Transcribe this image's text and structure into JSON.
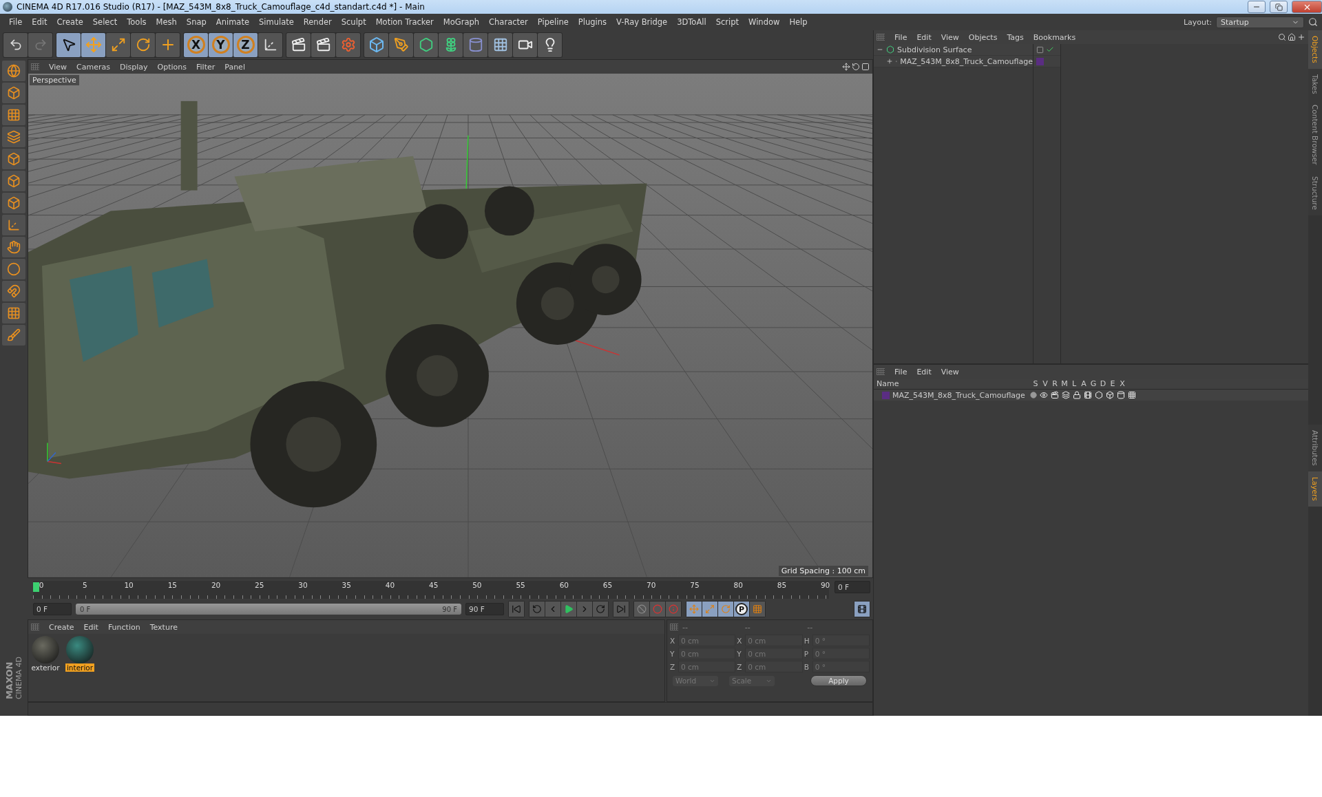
{
  "window": {
    "title": "CINEMA 4D R17.016 Studio (R17) - [MAZ_543M_8x8_Truck_Camouflage_c4d_standart.c4d *] - Main"
  },
  "menu": [
    "File",
    "Edit",
    "Create",
    "Select",
    "Tools",
    "Mesh",
    "Snap",
    "Animate",
    "Simulate",
    "Render",
    "Sculpt",
    "Motion Tracker",
    "MoGraph",
    "Character",
    "Pipeline",
    "Plugins",
    "V-Ray Bridge",
    "3DToAll",
    "Script",
    "Window",
    "Help"
  ],
  "layout": {
    "label": "Layout:",
    "value": "Startup"
  },
  "toolbar": [
    {
      "kind": "undo",
      "selected": false
    },
    {
      "kind": "redo",
      "selected": false
    },
    {
      "kind": "select",
      "selected": true
    },
    {
      "kind": "move",
      "selected": true
    },
    {
      "kind": "scale",
      "selected": false
    },
    {
      "kind": "rotate",
      "selected": false
    },
    {
      "kind": "transform",
      "selected": false
    },
    {
      "kind": "axis",
      "label": "X",
      "selected": true
    },
    {
      "kind": "axis",
      "label": "Y",
      "selected": true
    },
    {
      "kind": "axis",
      "label": "Z",
      "selected": true
    },
    {
      "kind": "coords",
      "selected": false
    },
    {
      "kind": "render",
      "selected": false
    },
    {
      "kind": "render",
      "selected": false
    },
    {
      "kind": "settings",
      "selected": false
    },
    {
      "kind": "cube",
      "selected": false
    },
    {
      "kind": "pen",
      "selected": false
    },
    {
      "kind": "subdivision",
      "selected": false
    },
    {
      "kind": "cloner",
      "selected": false
    },
    {
      "kind": "deformer",
      "selected": false
    },
    {
      "kind": "floor",
      "selected": false
    },
    {
      "kind": "camera",
      "selected": false
    },
    {
      "kind": "light",
      "selected": false
    }
  ],
  "viewport": {
    "menu": [
      "View",
      "Cameras",
      "Display",
      "Options",
      "Filter",
      "Panel"
    ],
    "camera_label": "Perspective",
    "grid_spacing": "Grid Spacing : 100 cm"
  },
  "timeline": {
    "ticks": [
      "0",
      "5",
      "10",
      "15",
      "20",
      "25",
      "30",
      "35",
      "40",
      "45",
      "50",
      "55",
      "60",
      "65",
      "70",
      "75",
      "80",
      "85",
      "90"
    ],
    "current_frame": "0 F",
    "start": "0 F",
    "range": {
      "start": "0 F",
      "end": "90 F",
      "level": 1
    },
    "end": "90 F",
    "param_key": "P"
  },
  "materials": {
    "menu": [
      "Create",
      "Edit",
      "Function",
      "Texture"
    ],
    "items": [
      {
        "name": "exterior",
        "selected": false
      },
      {
        "name": "interior",
        "selected": true
      }
    ]
  },
  "coordinates": {
    "headers": [
      "--",
      "--",
      "--"
    ],
    "rows": [
      {
        "label_1": "X",
        "value_1": "0 cm",
        "label_2": "X",
        "value_2": "0 cm",
        "label_3": "H",
        "value_3": "0 °"
      },
      {
        "label_1": "Y",
        "value_1": "0 cm",
        "label_2": "Y",
        "value_2": "0 cm",
        "label_3": "P",
        "value_3": "0 °"
      },
      {
        "label_1": "Z",
        "value_1": "0 cm",
        "label_2": "Z",
        "value_2": "0 cm",
        "label_3": "B",
        "value_3": "0 °"
      }
    ],
    "space": "World",
    "mode": "Scale",
    "apply": "Apply"
  },
  "brand": {
    "line_1": "MAXON",
    "line_2": "CINEMA 4D"
  },
  "object_manager": {
    "menu": [
      "File",
      "Edit",
      "View",
      "Objects",
      "Tags",
      "Bookmarks"
    ],
    "tree": [
      {
        "name": "Subdivision Surface",
        "kind": "subdivision",
        "expanded": true,
        "enabled": true,
        "children": [
          {
            "name": "MAZ_543M_8x8_Truck_Camouflage",
            "kind": "null",
            "expanded": false,
            "color": "#5a2d82"
          }
        ]
      }
    ]
  },
  "layer_manager": {
    "menu": [
      "File",
      "Edit",
      "View"
    ],
    "columns": [
      "Name",
      "S",
      "V",
      "R",
      "M",
      "L",
      "A",
      "G",
      "D",
      "E",
      "X"
    ],
    "rows": [
      {
        "name": "MAZ_543M_8x8_Truck_Camouflage",
        "color": "#5a2d82"
      }
    ]
  },
  "side_tabs_top": [
    {
      "label": "Objects",
      "selected": true
    },
    {
      "label": "Takes",
      "selected": false
    },
    {
      "label": "Content Browser",
      "selected": false
    },
    {
      "label": "Structure",
      "selected": false
    }
  ],
  "side_tabs_bottom": [
    {
      "label": "Attributes",
      "selected": false
    },
    {
      "label": "Layers",
      "selected": true
    }
  ]
}
